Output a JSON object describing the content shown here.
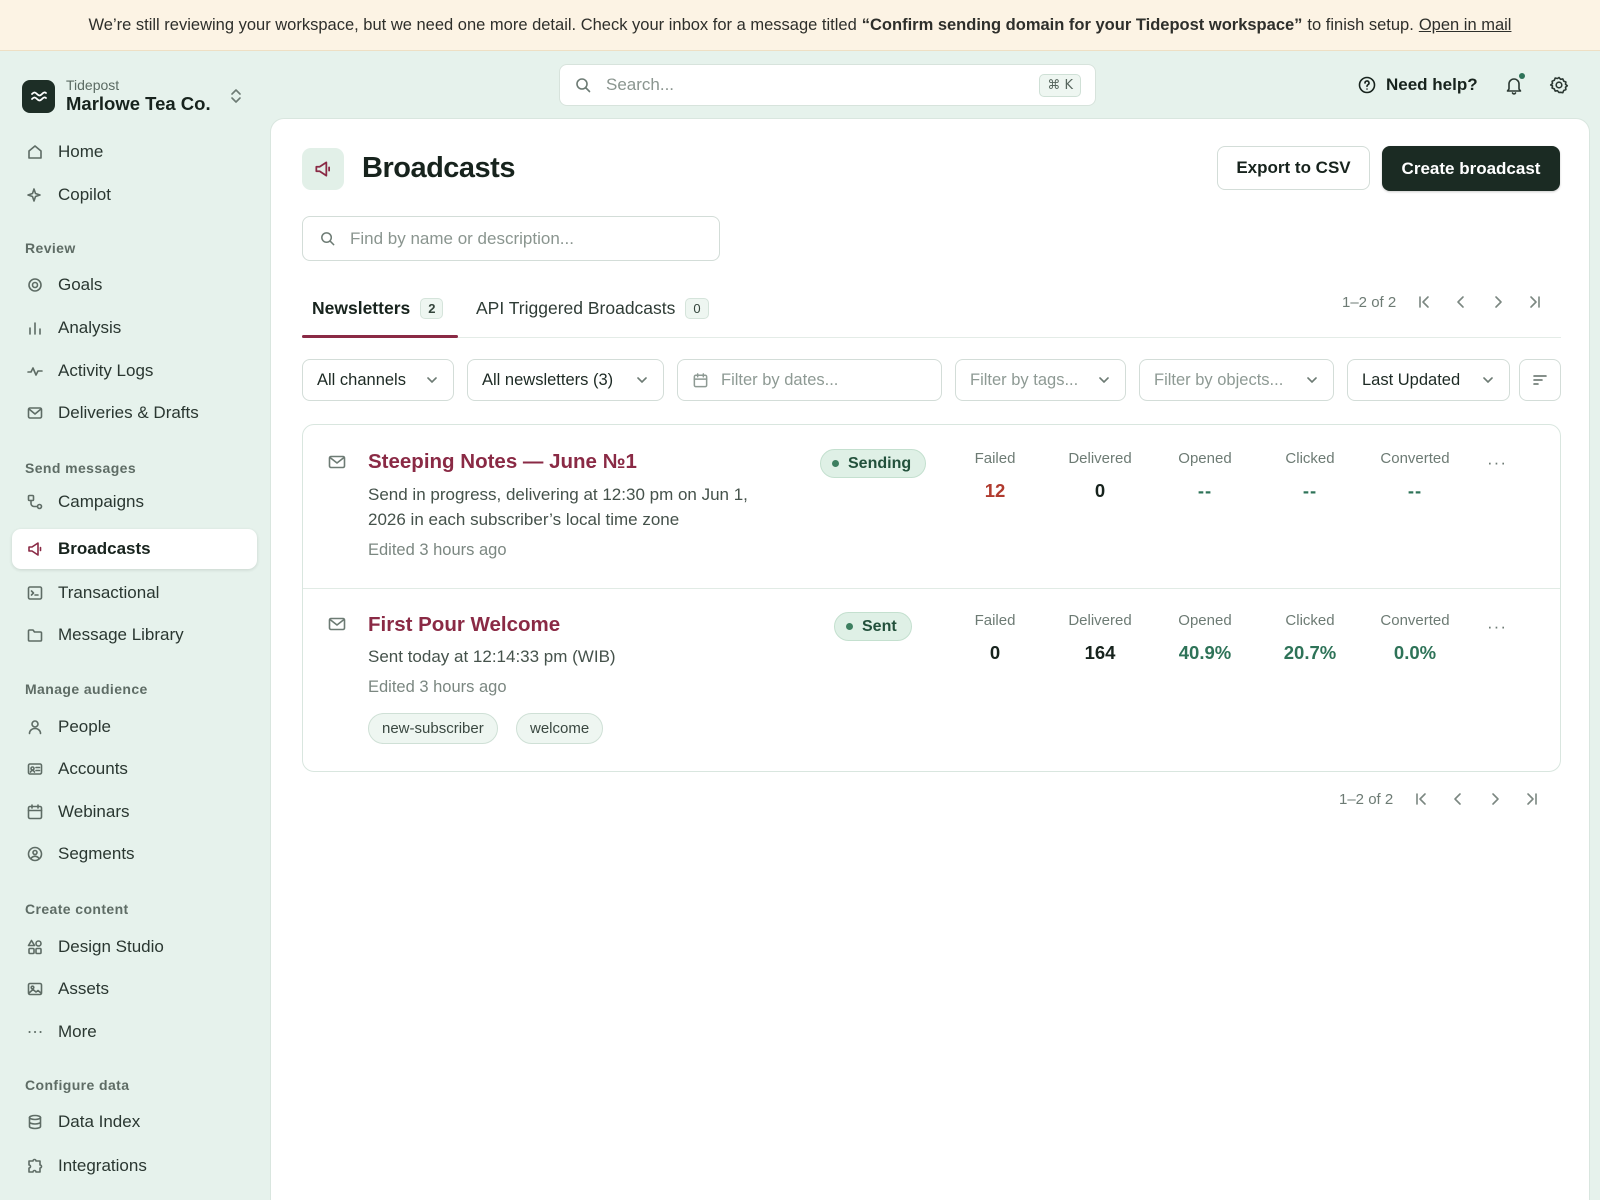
{
  "banner": {
    "text_before": "We’re still reviewing your workspace, but we need one more detail. Check your inbox for a message titled",
    "bold_title": "“Confirm sending domain for your Tidepost workspace”",
    "text_after": "to finish setup.",
    "link": "Open in mail"
  },
  "workspace": {
    "app": "Tidepost",
    "name": "Marlowe Tea Co."
  },
  "sidebar": {
    "top": [
      {
        "label": "Home",
        "icon": "home-icon"
      },
      {
        "label": "Copilot",
        "icon": "sparkle-icon"
      }
    ],
    "sections": {
      "review": "Review",
      "send": "Send messages",
      "audience": "Manage audience",
      "content": "Create content",
      "data": "Configure data"
    },
    "review": [
      {
        "label": "Goals",
        "icon": "target-icon"
      },
      {
        "label": "Analysis",
        "icon": "bar-chart-icon"
      },
      {
        "label": "Activity Logs",
        "icon": "pulse-icon"
      },
      {
        "label": "Deliveries & Drafts",
        "icon": "mail-icon"
      }
    ],
    "send": [
      {
        "label": "Campaigns",
        "icon": "workflow-icon"
      },
      {
        "label": "Broadcasts",
        "icon": "megaphone-icon",
        "active": true
      },
      {
        "label": "Transactional",
        "icon": "terminal-icon"
      },
      {
        "label": "Message Library",
        "icon": "folder-icon"
      }
    ],
    "audience": [
      {
        "label": "People",
        "icon": "person-icon"
      },
      {
        "label": "Accounts",
        "icon": "id-card-icon"
      },
      {
        "label": "Webinars",
        "icon": "calendar-icon"
      },
      {
        "label": "Segments",
        "icon": "user-circle-icon"
      }
    ],
    "content": [
      {
        "label": "Design Studio",
        "icon": "shapes-icon"
      },
      {
        "label": "Assets",
        "icon": "image-icon"
      },
      {
        "label": "More",
        "icon": "ellipsis-icon"
      }
    ],
    "data": [
      {
        "label": "Data Index",
        "icon": "database-icon"
      },
      {
        "label": "Integrations",
        "icon": "puzzle-icon"
      }
    ]
  },
  "topbar": {
    "search_placeholder": "Search...",
    "shortcut": "⌘ K",
    "help_label": "Need help?"
  },
  "page": {
    "title": "Broadcasts",
    "export_label": "Export to CSV",
    "create_label": "Create broadcast",
    "find_placeholder": "Find by name or description..."
  },
  "tabs": [
    {
      "label": "Newsletters",
      "count": "2",
      "active": true
    },
    {
      "label": "API Triggered Broadcasts",
      "count": "0",
      "active": false
    }
  ],
  "pagination": {
    "range": "1–2 of 2"
  },
  "filters": {
    "channels": "All channels",
    "newsletters": "All newsletters (3)",
    "dates": "Filter by dates...",
    "tags": "Filter by tags...",
    "objects": "Filter by objects...",
    "sort": "Last Updated"
  },
  "stat_labels": {
    "failed": "Failed",
    "delivered": "Delivered",
    "opened": "Opened",
    "clicked": "Clicked",
    "converted": "Converted"
  },
  "broadcasts": [
    {
      "title": "Steeping Notes — June №1",
      "description": "Send in progress, delivering at 12:30 pm on Jun 1, 2026 in each subscriber’s local time zone",
      "edited": "Edited 3 hours ago",
      "status": "Sending",
      "failed": "12",
      "delivered": "0",
      "opened": "--",
      "clicked": "--",
      "converted": "--",
      "tags": []
    },
    {
      "title": "First Pour Welcome",
      "description": "Sent today at 12:14:33 pm (WIB)",
      "edited": "Edited 3 hours ago",
      "status": "Sent",
      "failed": "0",
      "delivered": "164",
      "opened": "40.9%",
      "clicked": "20.7%",
      "converted": "0.0%",
      "tags": [
        "new-subscriber",
        "welcome"
      ]
    }
  ],
  "colors": {
    "accent": "#8a2a45",
    "primary_button": "#1b2b23",
    "status_green": "#2e7358",
    "failed_red": "#b03a2e",
    "banner_bg": "#fcf3e4",
    "sidebar_bg": "#e6f2ec"
  }
}
